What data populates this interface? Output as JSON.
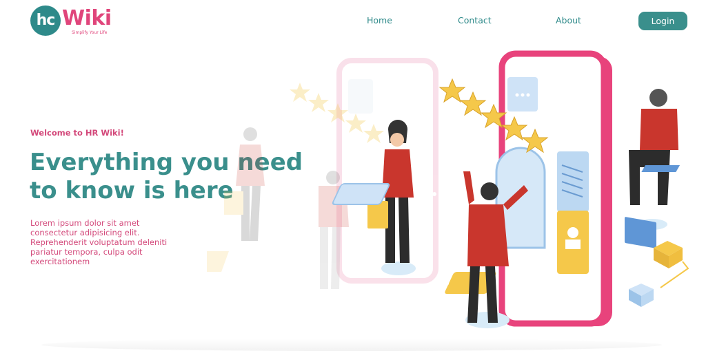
{
  "header": {
    "logo": {
      "badge_text": "hc",
      "word": "Wiki",
      "tagline": "Simplify Your Life"
    },
    "nav": [
      "Home",
      "Contact",
      "About"
    ],
    "login_label": "Login"
  },
  "hero": {
    "welcome": "Welcome to HR Wiki!",
    "headline": "Everything you need to know is here",
    "lead": "Lorem ipsum dolor sit amet consectetur adipisicing elit. Reprehenderit voluptatum deleniti pariatur tempora, culpa odit exercitationem"
  },
  "colors": {
    "brand_teal": "#3a8f8c",
    "brand_pink": "#e0457b",
    "accent_yellow": "#f5c84a",
    "accent_red": "#c9362d"
  }
}
